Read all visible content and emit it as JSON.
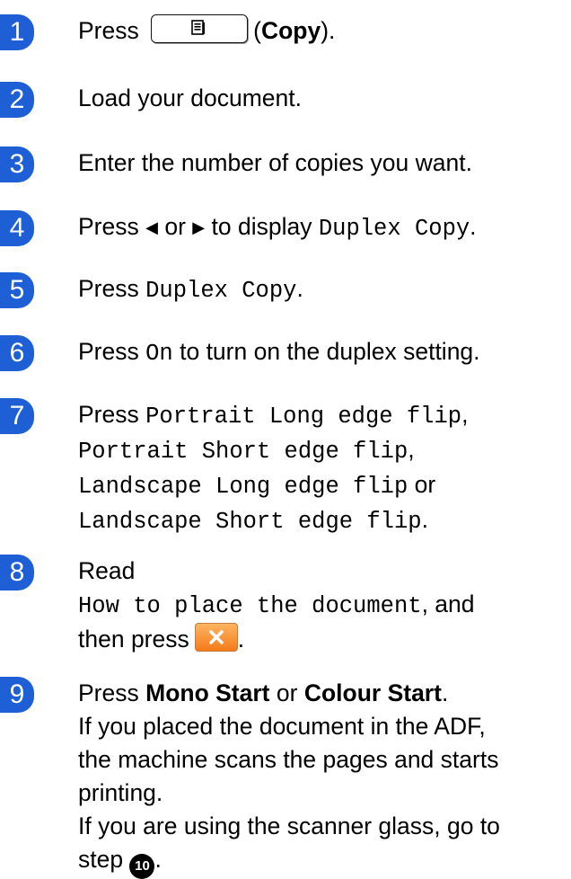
{
  "steps": [
    {
      "num": "1",
      "press": "Press",
      "close": "(",
      "bold": "Copy",
      "end": ")."
    },
    {
      "num": "2",
      "text": "Load your document."
    },
    {
      "num": "3",
      "text": "Enter the number of copies you want."
    },
    {
      "num": "4",
      "press": "Press",
      "left_arrow": "◀",
      "or": "or",
      "right_arrow": "▶",
      "mid": "to display",
      "mono": "Duplex Copy",
      "end": "."
    },
    {
      "num": "5",
      "press": "Press",
      "mono": "Duplex Copy",
      "end": "."
    },
    {
      "num": "6",
      "press": "Press",
      "mono": "On",
      "rest": "to turn on the duplex setting."
    },
    {
      "num": "7",
      "press": "Press",
      "opt1": "Portrait Long edge flip",
      "opt2": "Portrait Short edge flip",
      "opt3": "Landscape Long edge flip",
      "or": "or",
      "opt4": "Landscape Short edge flip",
      "comma": ",",
      "end": "."
    },
    {
      "num": "8",
      "read": "Read",
      "mono": "How to place the document",
      "and": ", and",
      "then": "then press",
      "end": "."
    },
    {
      "num": "9",
      "press": "Press",
      "bold1": "Mono Start",
      "or": "or",
      "bold2": "Colour Start",
      "end": ".",
      "line2": "If you placed the document in the ADF,",
      "line3": "the machine scans the pages and starts",
      "line4": "printing.",
      "line5": "If you are using the scanner glass, go to",
      "line6": "step",
      "step_ref": "10",
      "line6_end": "."
    }
  ]
}
